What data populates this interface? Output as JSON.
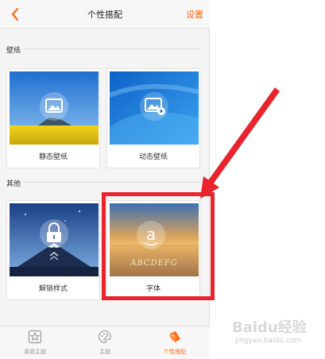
{
  "header": {
    "back_icon": "chevron-left-icon",
    "title": "个性搭配",
    "settings_label": "设置"
  },
  "sections": {
    "wallpaper_label": "壁纸",
    "other_label": "其他"
  },
  "cards": {
    "static_wallpaper": {
      "label": "静态壁纸",
      "icon": "image-icon"
    },
    "dynamic_wallpaper": {
      "label": "动态壁纸",
      "icon": "video-image-icon"
    },
    "unlock_style": {
      "label": "解锁样式",
      "icon": "lock-icon"
    },
    "font": {
      "label": "字体",
      "icon": "letter-a-icon",
      "sample_text": "ABCDEFG"
    }
  },
  "tabbar": {
    "tabs": [
      {
        "label": "桌面主题",
        "icon": "star-icon"
      },
      {
        "label": "主题",
        "icon": "palette-icon"
      },
      {
        "label": "个性搭配",
        "icon": "tag-icon",
        "active": true
      }
    ]
  },
  "colors": {
    "accent": "#ff6a13",
    "annotation_red": "#e8242c"
  },
  "watermark": {
    "logo_text": "Baidu经验",
    "url": "jingyan.baidu.com"
  }
}
